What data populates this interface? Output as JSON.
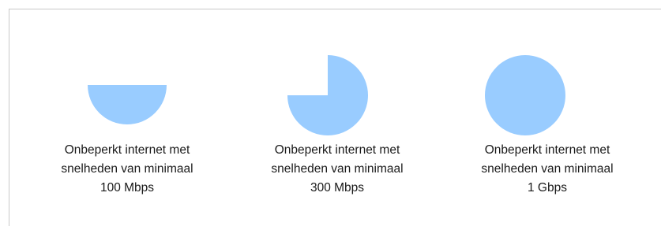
{
  "colors": {
    "indicator_fill": "#99ccff",
    "panel_border": "#c9c9c9",
    "text": "#1a1a1a"
  },
  "tiers": [
    {
      "icon": "pie-indicator-half",
      "fill_fraction": 0.5,
      "line1": "Onbeperkt internet met",
      "line2": "snelheden van minimaal",
      "line3": "100 Mbps"
    },
    {
      "icon": "pie-indicator-three-quarters",
      "fill_fraction": 0.75,
      "line1": "Onbeperkt internet met",
      "line2": "snelheden van minimaal",
      "line3": "300 Mbps"
    },
    {
      "icon": "pie-indicator-full",
      "fill_fraction": 1.0,
      "line1": "Onbeperkt internet met",
      "line2": "snelheden van minimaal",
      "line3": "1 Gbps"
    }
  ]
}
